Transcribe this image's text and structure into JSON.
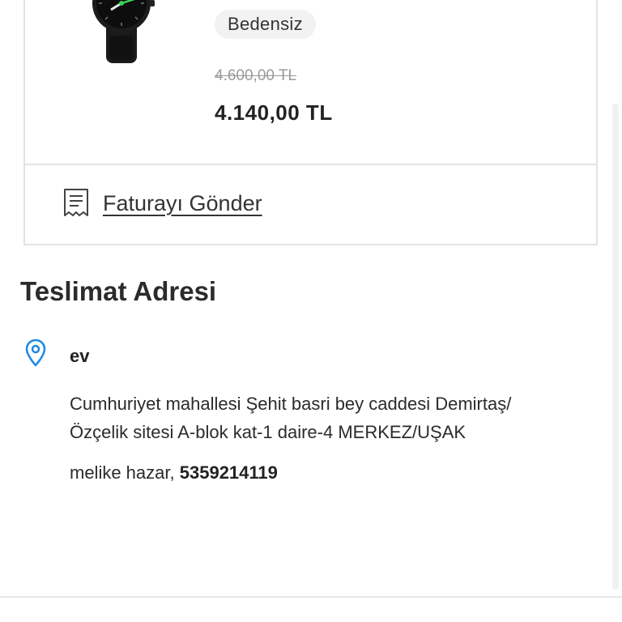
{
  "product": {
    "image_icon": "watch-image",
    "size_badge": "Bedensiz",
    "old_price": "4.600,00 TL",
    "price": "4.140,00 TL"
  },
  "invoice": {
    "icon": "receipt-icon",
    "label": "Faturayı Gönder"
  },
  "delivery": {
    "title": "Teslimat Adresi",
    "icon": "location-pin-icon",
    "address_name": "ev",
    "address_line1": "Cumhuriyet mahallesi Şehit basri bey caddesi  Demirtaş/",
    "address_line2": "Özçelik sitesi A-blok kat-1 daire-4 MERKEZ/UŞAK",
    "recipient": "melike hazar,",
    "phone": "5359214119"
  },
  "colors": {
    "accent_blue": "#1e88e5",
    "border": "#e3e3e3",
    "badge_bg": "#f2f2f2",
    "watch_accent": "#39d353"
  }
}
